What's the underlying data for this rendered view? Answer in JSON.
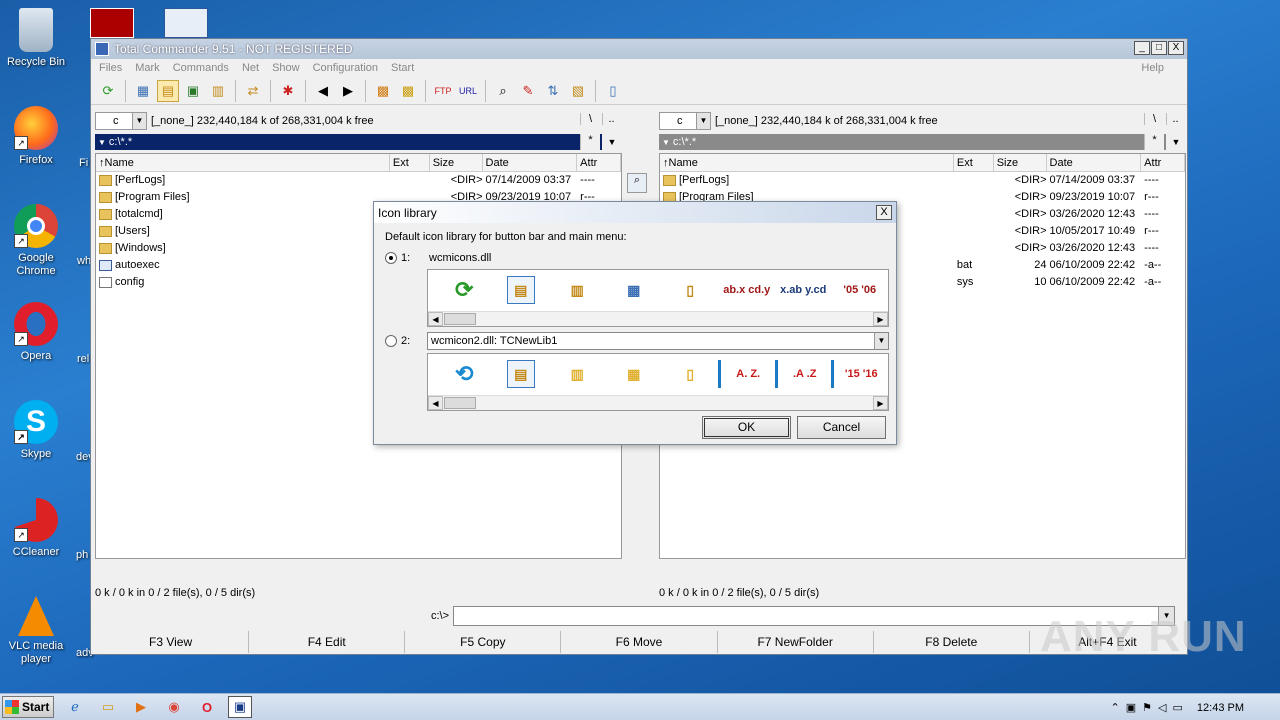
{
  "desktop": {
    "icons": [
      {
        "label": "Recycle Bin"
      },
      {
        "label": "Firefox"
      },
      {
        "label": "Google Chrome"
      },
      {
        "label": "Opera"
      },
      {
        "label": "Skype"
      },
      {
        "label": "CCleaner"
      },
      {
        "label": "VLC media player"
      }
    ],
    "partial_labels": [
      "Fi",
      "wh",
      "rel",
      "dev",
      "ph",
      "adv"
    ]
  },
  "window": {
    "title": "Total Commander 9.51 - NOT REGISTERED",
    "controls": [
      "_",
      "□",
      "X"
    ],
    "menu": [
      "Files",
      "Mark",
      "Commands",
      "Net",
      "Show",
      "Configuration",
      "Start"
    ],
    "help": "Help"
  },
  "left_panel": {
    "drive": "c",
    "drive_info": "[_none_]  232,440,184 k of 268,331,004 k free",
    "backslash": "\\",
    "dotdot": "..",
    "path": "c:\\*.*",
    "star": "*",
    "columns": {
      "name": "Name",
      "ext": "Ext",
      "size": "Size",
      "date": "Date",
      "attr": "Attr"
    },
    "rows": [
      {
        "name": "[PerfLogs]",
        "ext": "",
        "size": "<DIR>",
        "date": "07/14/2009 03:37",
        "attr": "----",
        "type": "folder"
      },
      {
        "name": "[Program Files]",
        "ext": "",
        "size": "<DIR>",
        "date": "09/23/2019 10:07",
        "attr": "r---",
        "type": "folder"
      },
      {
        "name": "[totalcmd]",
        "ext": "",
        "size": "",
        "date": "",
        "attr": "",
        "type": "folder"
      },
      {
        "name": "[Users]",
        "ext": "",
        "size": "",
        "date": "",
        "attr": "",
        "type": "folder"
      },
      {
        "name": "[Windows]",
        "ext": "",
        "size": "",
        "date": "",
        "attr": "",
        "type": "folder"
      },
      {
        "name": "autoexec",
        "ext": "",
        "size": "",
        "date": "",
        "attr": "",
        "type": "bat"
      },
      {
        "name": "config",
        "ext": "",
        "size": "",
        "date": "",
        "attr": "",
        "type": "file"
      }
    ],
    "status": "0 k / 0 k in 0 / 2 file(s), 0 / 5 dir(s)"
  },
  "right_panel": {
    "drive": "c",
    "drive_info": "[_none_]  232,440,184 k of 268,331,004 k free",
    "backslash": "\\",
    "dotdot": "..",
    "path": "c:\\*.*",
    "star": "*",
    "columns": {
      "name": "Name",
      "ext": "Ext",
      "size": "Size",
      "date": "Date",
      "attr": "Attr"
    },
    "rows": [
      {
        "name": "[PerfLogs]",
        "ext": "",
        "size": "<DIR>",
        "date": "07/14/2009 03:37",
        "attr": "----",
        "type": "folder"
      },
      {
        "name": "[Program Files]",
        "ext": "",
        "size": "<DIR>",
        "date": "09/23/2019 10:07",
        "attr": "r---",
        "type": "folder"
      },
      {
        "name": "",
        "ext": "",
        "size": "<DIR>",
        "date": "03/26/2020 12:43",
        "attr": "----",
        "type": "none"
      },
      {
        "name": "",
        "ext": "",
        "size": "<DIR>",
        "date": "10/05/2017 10:49",
        "attr": "r---",
        "type": "none"
      },
      {
        "name": "",
        "ext": "",
        "size": "<DIR>",
        "date": "03/26/2020 12:43",
        "attr": "----",
        "type": "none"
      },
      {
        "name": "",
        "ext": "bat",
        "size": "24",
        "date": "06/10/2009 22:42",
        "attr": "-a--",
        "type": "none"
      },
      {
        "name": "",
        "ext": "sys",
        "size": "10",
        "date": "06/10/2009 22:42",
        "attr": "-a--",
        "type": "none"
      }
    ],
    "status": "0 k / 0 k in 0 / 2 file(s), 0 / 5 dir(s)"
  },
  "cmdline": {
    "prompt": "c:\\>",
    "value": ""
  },
  "fkeys": [
    "F3 View",
    "F4 Edit",
    "F5 Copy",
    "F6 Move",
    "F7 NewFolder",
    "F8 Delete",
    "Alt+F4 Exit"
  ],
  "dialog": {
    "title": "Icon library",
    "close": "X",
    "description": "Default icon library for button bar and main menu:",
    "option1_label": "1:",
    "option1_lib": "wcmicons.dll",
    "option2_label": "2:",
    "option2_lib": "wcmicon2.dll: TCNewLib1",
    "strip1_texts": [
      "ab.x cd.y",
      "x.ab y.cd",
      "'05 '06"
    ],
    "strip2_texts": [
      "A. Z.",
      ".A .Z",
      "'15 '16"
    ],
    "ok": "OK",
    "cancel": "Cancel"
  },
  "taskbar": {
    "start": "Start",
    "clock": "12:43 PM"
  },
  "watermark": "ANY RUN"
}
